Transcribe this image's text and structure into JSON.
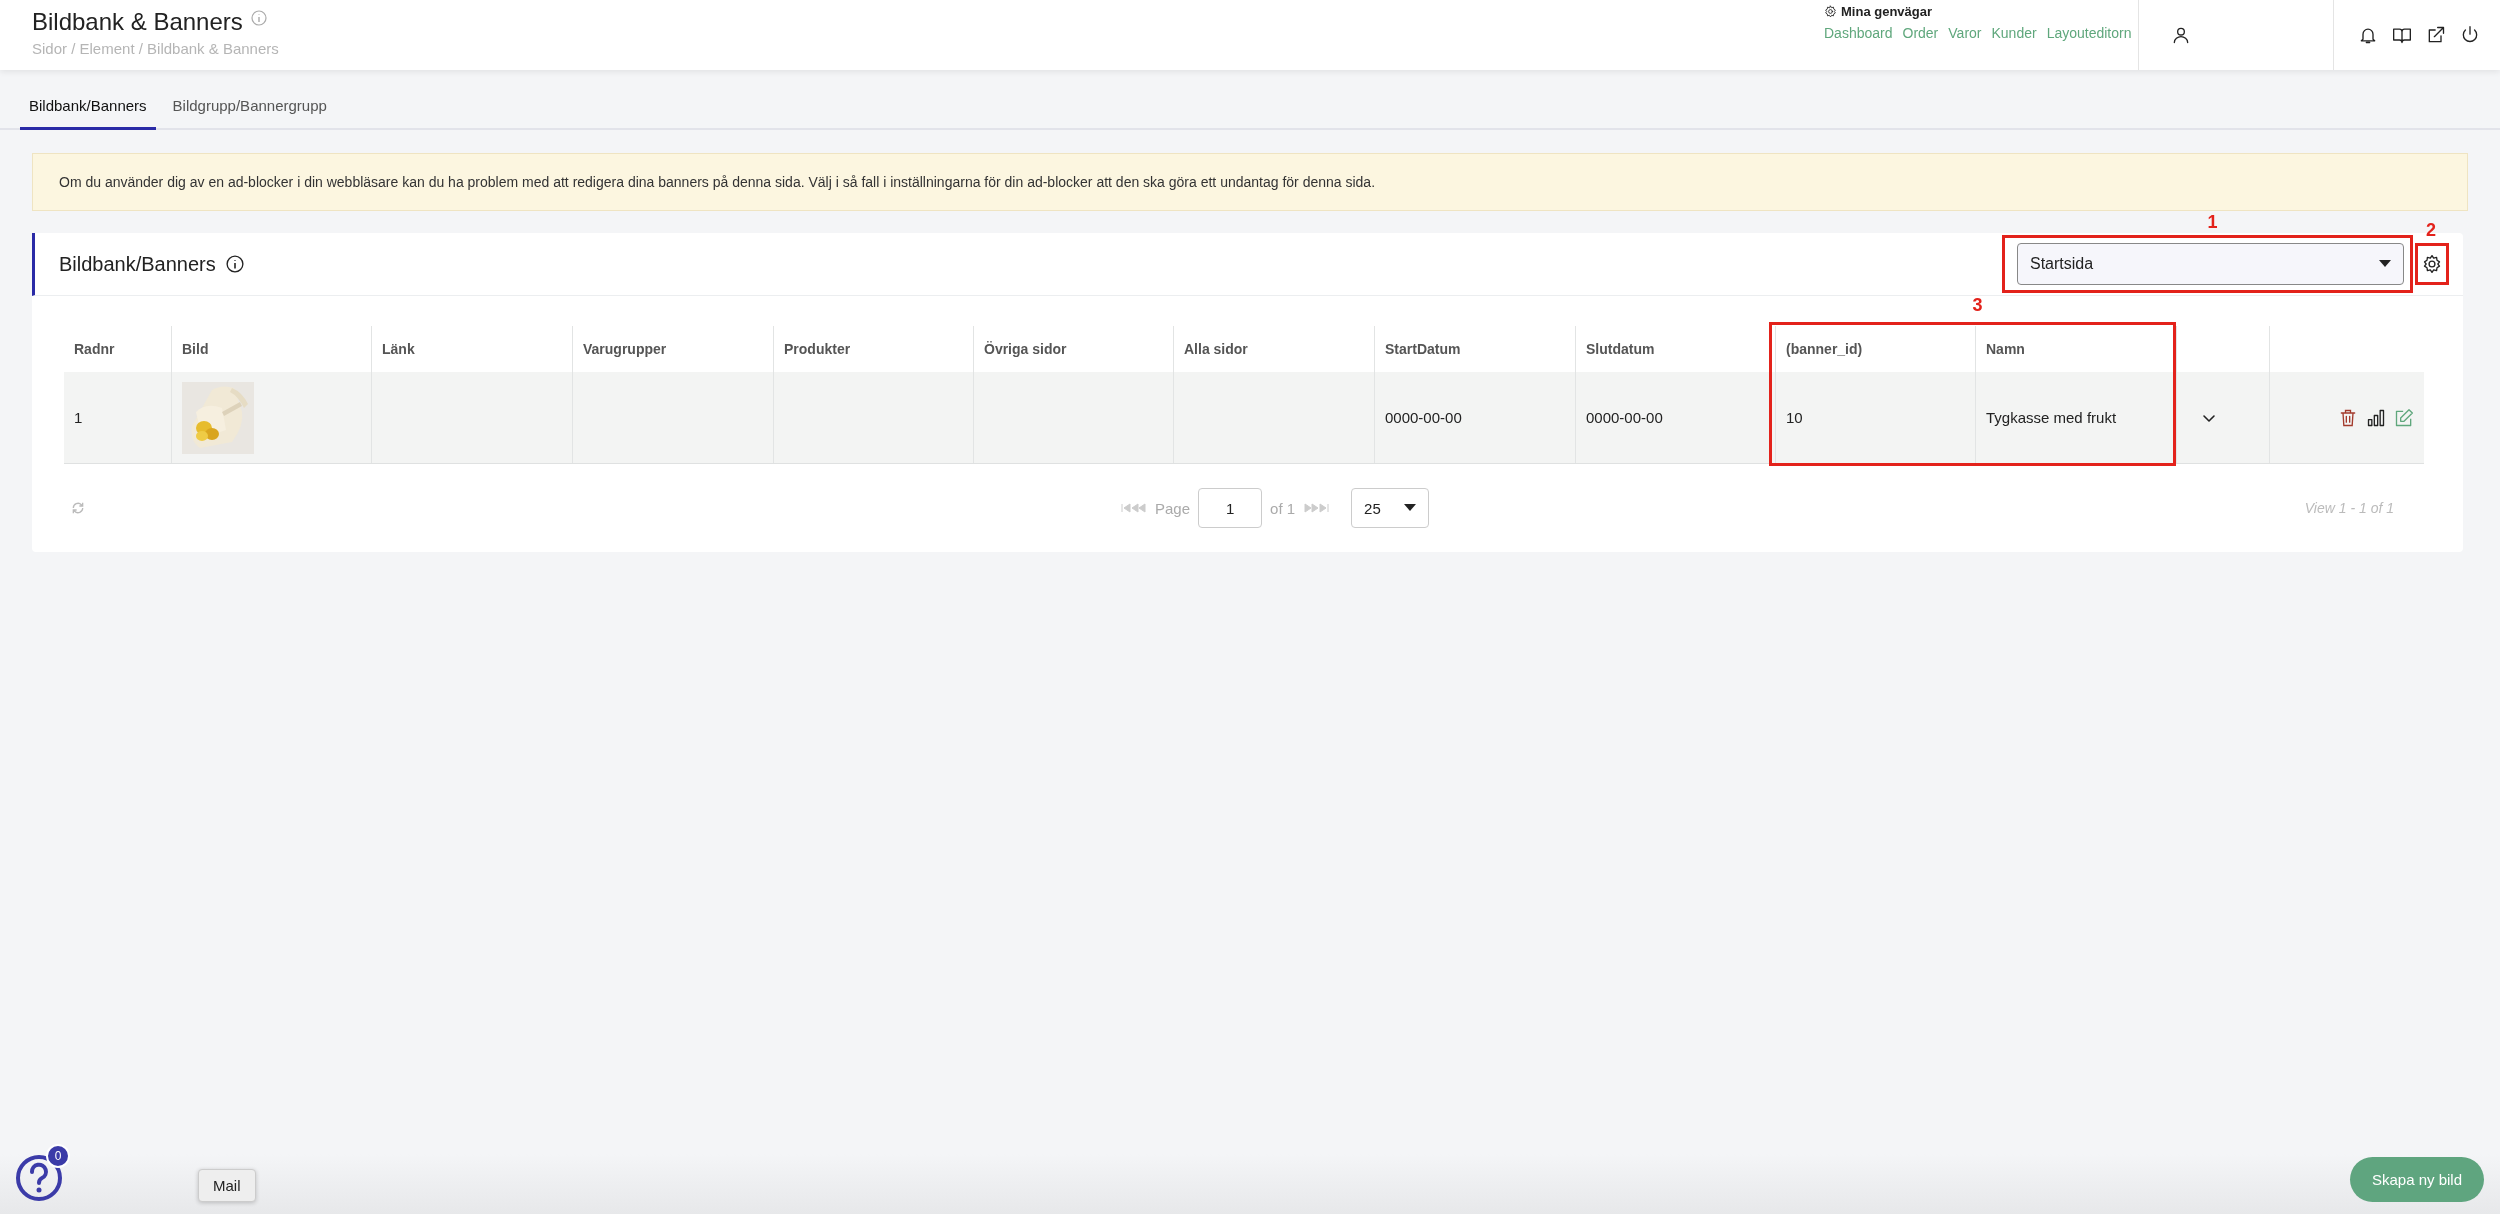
{
  "header": {
    "title": "Bildbank & Banners",
    "breadcrumb": "Sidor / Element / Bildbank & Banners",
    "shortcuts": {
      "title": "Mina genvägar",
      "links": [
        "Dashboard",
        "Order",
        "Varor",
        "Kunder",
        "Layouteditorn"
      ]
    }
  },
  "tabs": [
    {
      "label": "Bildbank/Banners",
      "selected": true
    },
    {
      "label": "Bildgrupp/Bannergrupp",
      "selected": false
    }
  ],
  "notice": "Om du använder dig av en ad-blocker i din webbläsare kan du ha problem med att redigera dina banners på denna sida. Välj i så fall i inställningarna för din ad-blocker att den ska göra ett undantag för denna sida.",
  "card": {
    "title": "Bildbank/Banners",
    "select": {
      "value": "Startsida"
    }
  },
  "table": {
    "columns": [
      "Radnr",
      "Bild",
      "Länk",
      "Varugrupper",
      "Produkter",
      "Övriga sidor",
      "Alla sidor",
      "StartDatum",
      "Slutdatum",
      "(banner_id)",
      "Namn"
    ],
    "rows": [
      {
        "radnr": "1",
        "startdatum": "0000-00-00",
        "slutdatum": "0000-00-00",
        "banner_id": "10",
        "namn": "Tygkasse med frukt"
      }
    ]
  },
  "pagination": {
    "page_label": "Page",
    "page": "1",
    "of": "of 1",
    "page_size": "25",
    "view": "View 1 - 1 of 1"
  },
  "annotations": [
    {
      "label": "1"
    },
    {
      "label": "2"
    },
    {
      "label": "3"
    }
  ],
  "help": {
    "badge": "0"
  },
  "tooltip": "Mail",
  "create_button": "Skapa ny bild"
}
